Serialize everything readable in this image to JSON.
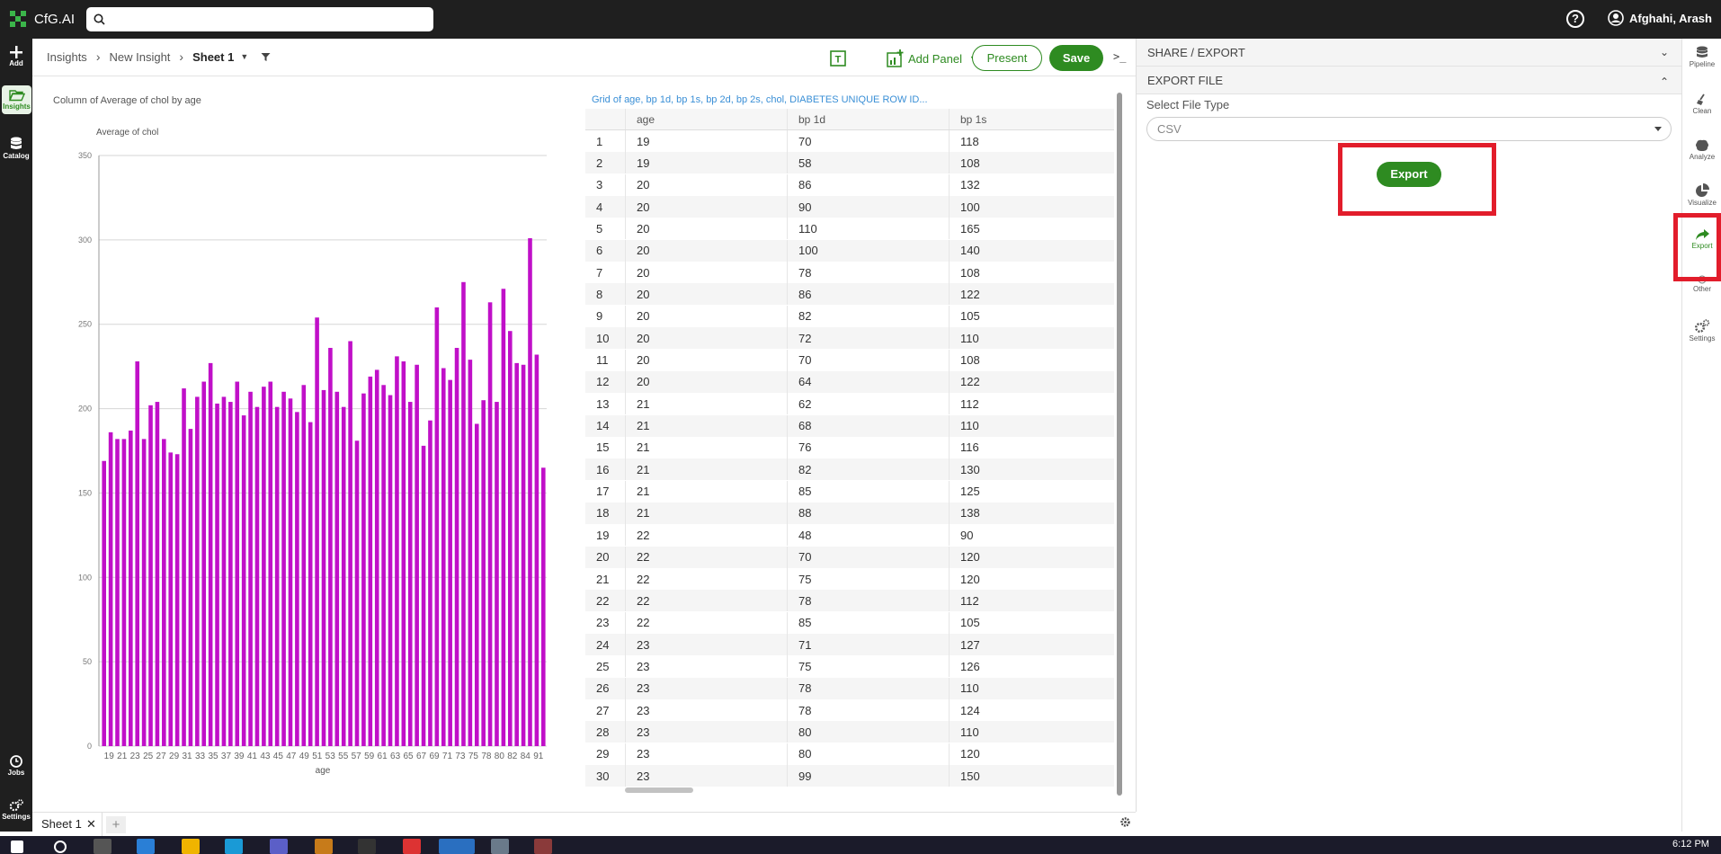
{
  "app": {
    "name": "CfG.AI",
    "user": "Afghahi, Arash"
  },
  "leftnav": [
    {
      "label": "Add",
      "icon": "plus-icon"
    },
    {
      "label": "Insights",
      "icon": "folder-open-icon",
      "active": true
    },
    {
      "label": "Catalog",
      "icon": "database-icon"
    },
    {
      "label": "Jobs",
      "icon": "clock-icon"
    },
    {
      "label": "Settings",
      "icon": "gears-icon"
    }
  ],
  "breadcrumb": [
    "Insights",
    "New Insight",
    "Sheet 1"
  ],
  "toolbar": {
    "add_panel": "Add Panel",
    "present": "Present",
    "save": "Save",
    "terminal": ">_"
  },
  "chart_data": {
    "type": "bar",
    "title": "Column of Average of chol by age",
    "ylabel": "Average of chol",
    "xlabel": "age",
    "ylim": [
      0,
      350
    ],
    "yticks": [
      0,
      50,
      100,
      150,
      200,
      250,
      300,
      350
    ],
    "xticks": [
      "19",
      "21",
      "23",
      "25",
      "27",
      "29",
      "31",
      "33",
      "35",
      "37",
      "39",
      "41",
      "43",
      "45",
      "47",
      "49",
      "51",
      "53",
      "55",
      "57",
      "59",
      "61",
      "63",
      "65",
      "67",
      "69",
      "71",
      "73",
      "75",
      "78",
      "80",
      "82",
      "84",
      "91"
    ],
    "color": "#c010c8",
    "values": [
      169,
      186,
      182,
      182,
      187,
      228,
      182,
      202,
      204,
      182,
      174,
      173,
      212,
      188,
      207,
      216,
      227,
      203,
      207,
      204,
      216,
      196,
      210,
      201,
      213,
      216,
      201,
      210,
      206,
      198,
      214,
      192,
      254,
      211,
      236,
      210,
      201,
      240,
      181,
      209,
      219,
      223,
      214,
      208,
      231,
      228,
      204,
      226,
      178,
      193,
      260,
      224,
      217,
      236,
      275,
      229,
      191,
      205,
      263,
      204,
      271,
      246,
      227,
      226,
      301,
      232,
      165
    ]
  },
  "grid": {
    "title": "Grid of age, bp 1d, bp 1s, bp 2d, bp 2s, chol, DIABETES UNIQUE ROW ID...",
    "columns": [
      "",
      "age",
      "bp 1d",
      "bp 1s"
    ],
    "rows": [
      [
        "1",
        "19",
        "70",
        "118"
      ],
      [
        "2",
        "19",
        "58",
        "108"
      ],
      [
        "3",
        "20",
        "86",
        "132"
      ],
      [
        "4",
        "20",
        "90",
        "100"
      ],
      [
        "5",
        "20",
        "110",
        "165"
      ],
      [
        "6",
        "20",
        "100",
        "140"
      ],
      [
        "7",
        "20",
        "78",
        "108"
      ],
      [
        "8",
        "20",
        "86",
        "122"
      ],
      [
        "9",
        "20",
        "82",
        "105"
      ],
      [
        "10",
        "20",
        "72",
        "110"
      ],
      [
        "11",
        "20",
        "70",
        "108"
      ],
      [
        "12",
        "20",
        "64",
        "122"
      ],
      [
        "13",
        "21",
        "62",
        "112"
      ],
      [
        "14",
        "21",
        "68",
        "110"
      ],
      [
        "15",
        "21",
        "76",
        "116"
      ],
      [
        "16",
        "21",
        "82",
        "130"
      ],
      [
        "17",
        "21",
        "85",
        "125"
      ],
      [
        "18",
        "21",
        "88",
        "138"
      ],
      [
        "19",
        "22",
        "48",
        "90"
      ],
      [
        "20",
        "22",
        "70",
        "120"
      ],
      [
        "21",
        "22",
        "75",
        "120"
      ],
      [
        "22",
        "22",
        "78",
        "112"
      ],
      [
        "23",
        "22",
        "85",
        "105"
      ],
      [
        "24",
        "23",
        "71",
        "127"
      ],
      [
        "25",
        "23",
        "75",
        "126"
      ],
      [
        "26",
        "23",
        "78",
        "110"
      ],
      [
        "27",
        "23",
        "78",
        "124"
      ],
      [
        "28",
        "23",
        "80",
        "110"
      ],
      [
        "29",
        "23",
        "80",
        "120"
      ],
      [
        "30",
        "23",
        "99",
        "150"
      ]
    ]
  },
  "panel": {
    "share_export": "SHARE / EXPORT",
    "export_file": "EXPORT FILE",
    "file_type_label": "Select File Type",
    "file_type_value": "CSV",
    "export_button": "Export"
  },
  "rightnav": [
    {
      "label": "Pipeline",
      "icon": "database-icon"
    },
    {
      "label": "Clean",
      "icon": "broom-icon"
    },
    {
      "label": "Analyze",
      "icon": "brain-icon"
    },
    {
      "label": "Visualize",
      "icon": "pie-chart-icon"
    },
    {
      "label": "Export",
      "icon": "share-arrow-icon",
      "active": true
    },
    {
      "label": "Other",
      "icon": "circle-icon"
    },
    {
      "label": "Settings",
      "icon": "gears-icon"
    }
  ],
  "bottom": {
    "sheet_tab": "Sheet 1",
    "add_tab": "+"
  },
  "taskbar": {
    "time": "6:12 PM"
  }
}
